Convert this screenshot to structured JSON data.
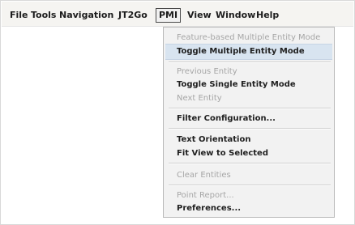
{
  "menubar": {
    "items": [
      "File",
      "Tools",
      "Navigation",
      "JT2Go",
      "PMI",
      "View",
      "Window",
      "Help"
    ],
    "active_index": 4
  },
  "pmi_menu": {
    "items": [
      {
        "label": "Feature-based Multiple Entity Mode",
        "enabled": false
      },
      {
        "label": "Toggle Multiple Entity Mode",
        "enabled": true,
        "highlighted": true
      },
      {
        "label": "Previous Entity",
        "enabled": false
      },
      {
        "label": "Toggle Single Entity Mode",
        "enabled": true
      },
      {
        "label": "Next Entity",
        "enabled": false
      },
      {
        "label": "Filter Configuration...",
        "enabled": true
      },
      {
        "label": "Text Orientation",
        "enabled": true
      },
      {
        "label": "Fit View to Selected",
        "enabled": true
      },
      {
        "label": "Clear Entities",
        "enabled": false
      },
      {
        "label": "Point Report...",
        "enabled": false
      },
      {
        "label": "Preferences...",
        "enabled": true
      }
    ]
  }
}
